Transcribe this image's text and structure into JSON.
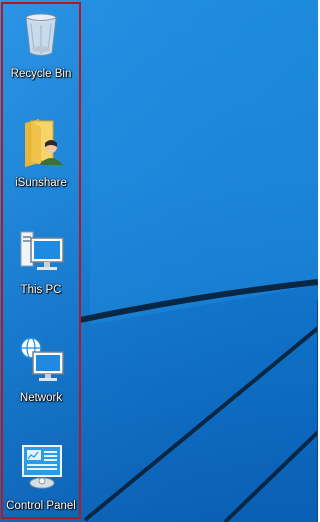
{
  "desktop": {
    "wallpaper_colors": {
      "base": "#1680d6",
      "light": "#3aa0ea",
      "dark": "#0a5fb3",
      "line": "#082745"
    },
    "highlight_color": "#b11a23",
    "icons": [
      {
        "label": "Recycle Bin",
        "icon": "recycle-bin-icon"
      },
      {
        "label": "iSunshare",
        "icon": "user-folder-icon"
      },
      {
        "label": "This PC",
        "icon": "computer-icon"
      },
      {
        "label": "Network",
        "icon": "network-icon"
      },
      {
        "label": "Control Panel",
        "icon": "control-panel-icon"
      }
    ]
  }
}
